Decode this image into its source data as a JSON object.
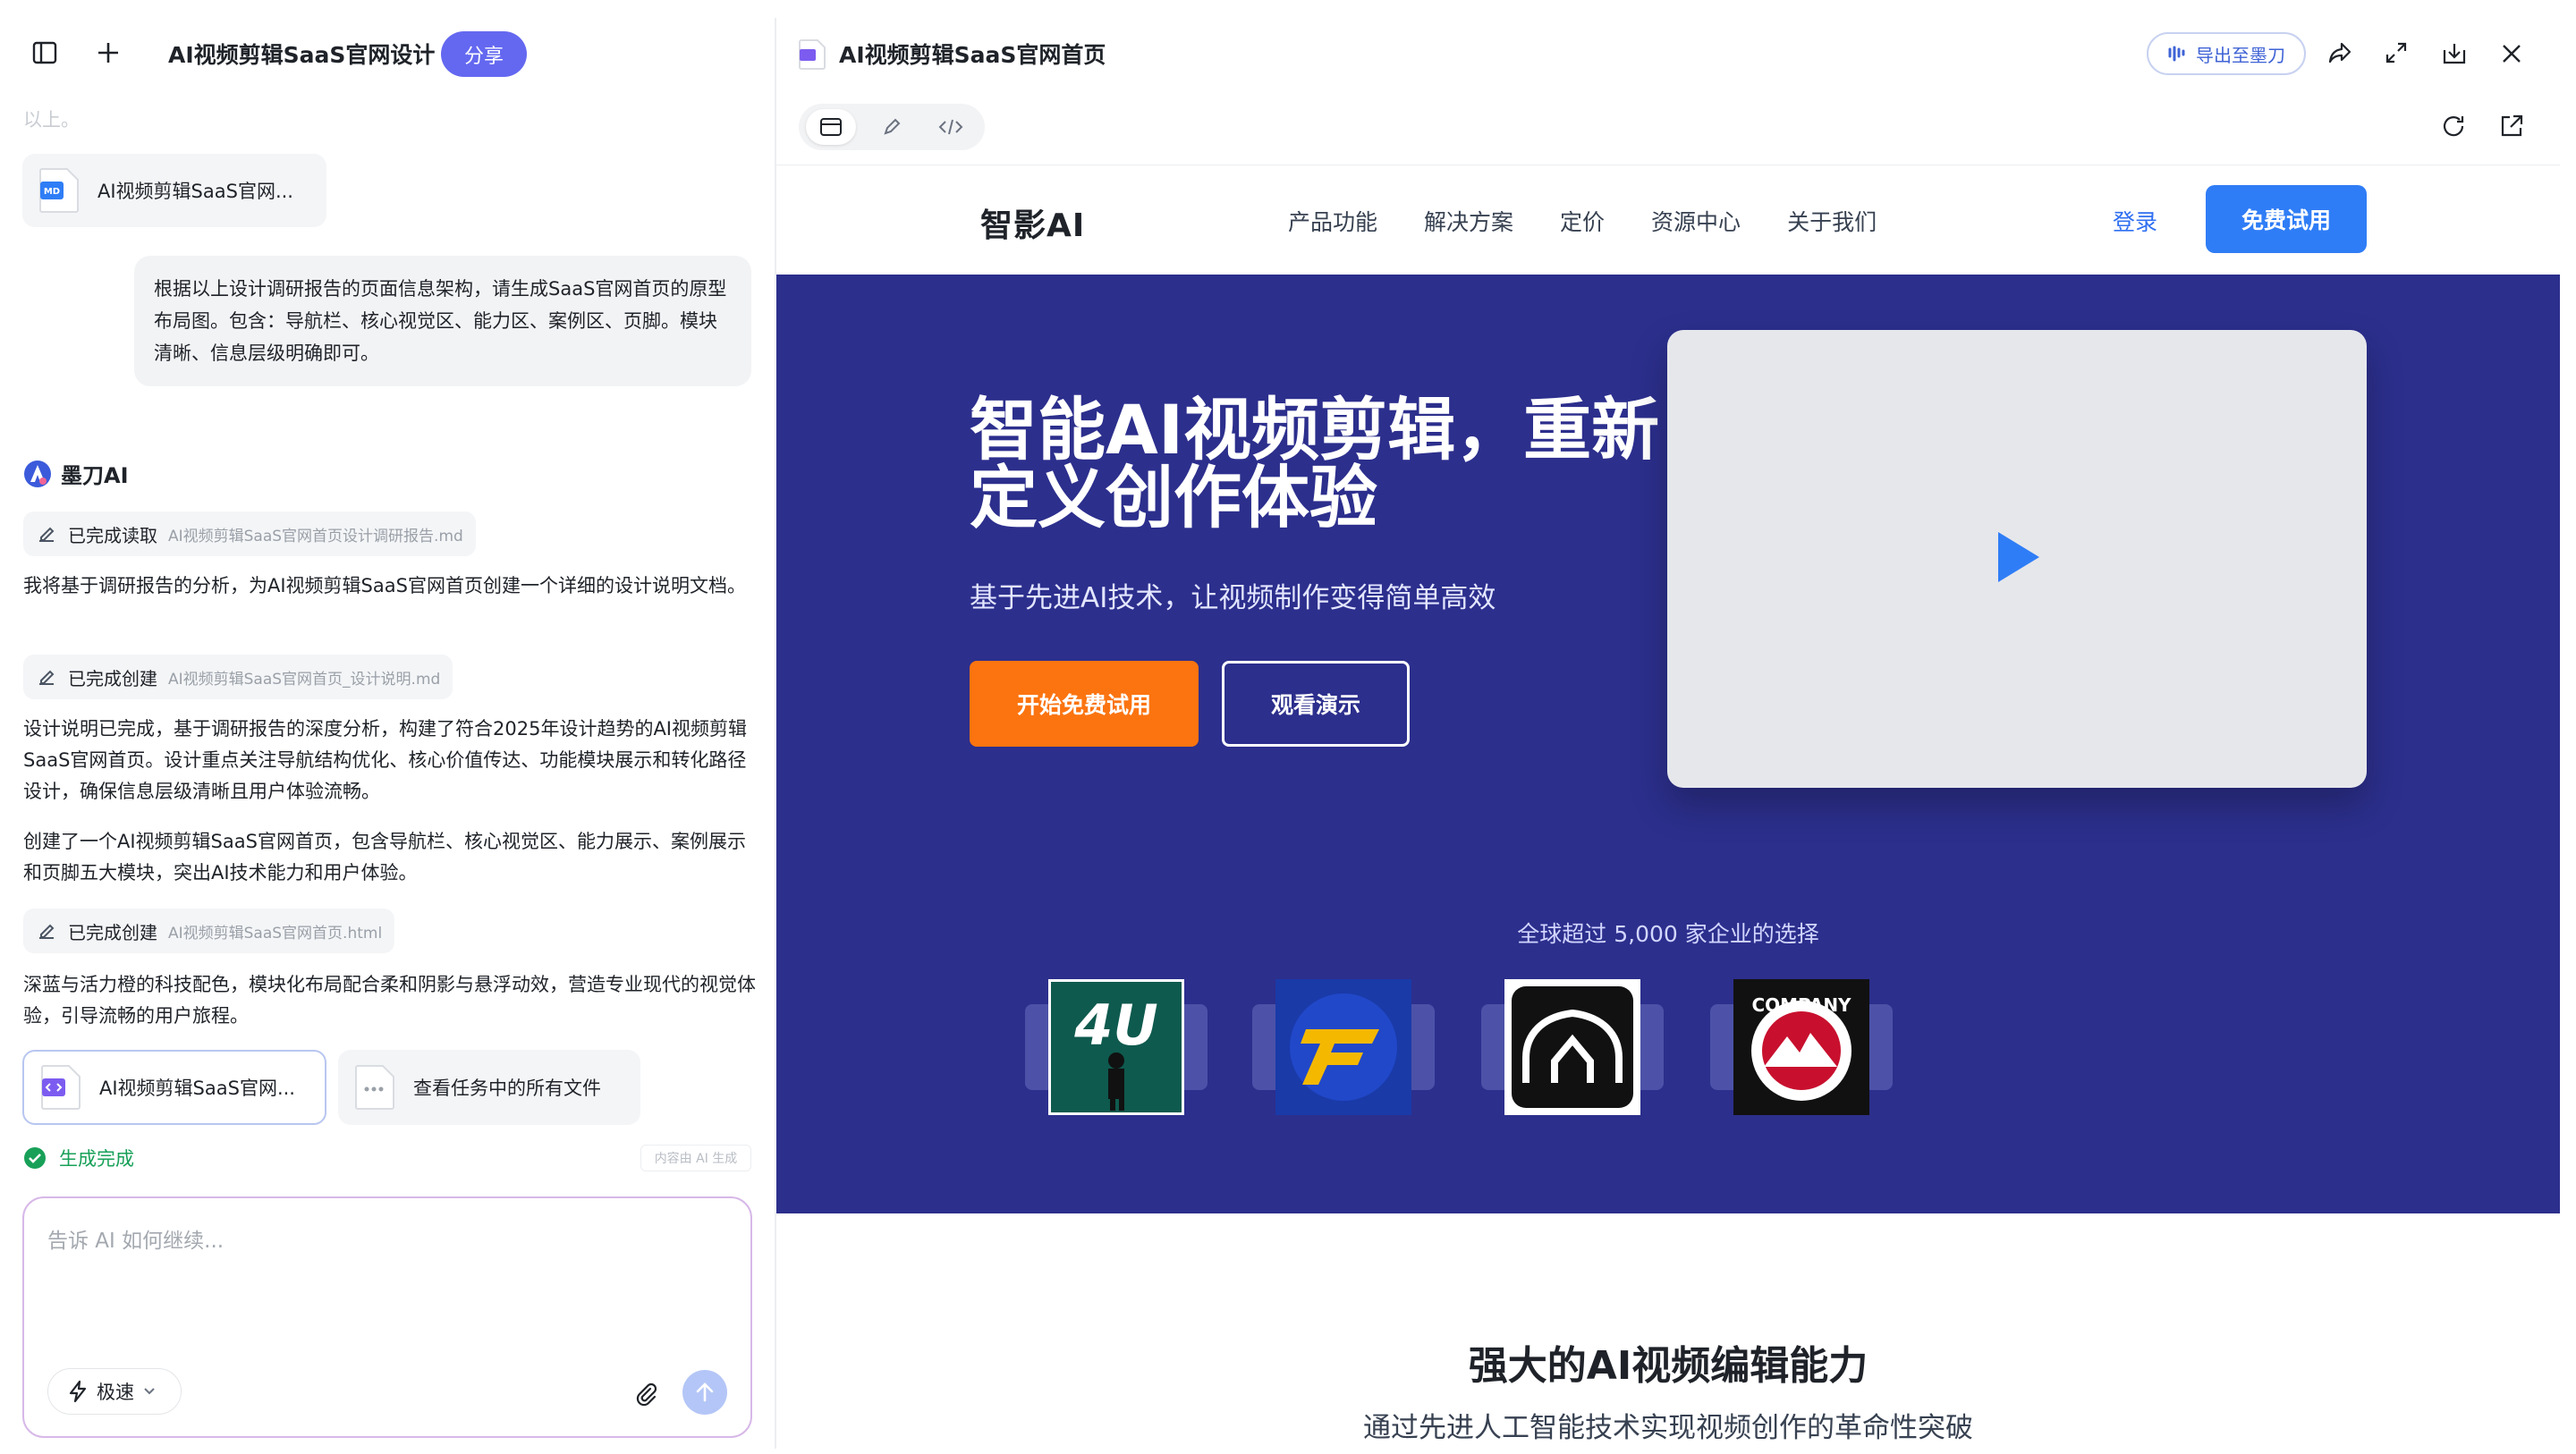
{
  "left_panel": {
    "project_title": "AI视频剪辑SaaS官网设计",
    "share_label": "分享",
    "faded_text": "以上。",
    "files": {
      "md_file": "AI视频剪辑SaaS官网...",
      "html_file": "AI视频剪辑SaaS官网...",
      "all_files": "查看任务中的所有文件"
    },
    "user_message": "根据以上设计调研报告的页面信息架构，请生成SaaS官网首页的原型布局图。包含：导航栏、核心视觉区、能力区、案例区、页脚。模块清晰、信息层级明确即可。",
    "agent_name": "墨刀AI",
    "steps": [
      {
        "label": "已完成读取",
        "file": "AI视频剪辑SaaS官网首页设计调研报告.md"
      },
      {
        "label": "已完成创建",
        "file": "AI视频剪辑SaaS官网首页_设计说明.md"
      },
      {
        "label": "已完成创建",
        "file": "AI视频剪辑SaaS官网首页.html"
      }
    ],
    "paragraphs": [
      "我将基于调研报告的分析，为AI视频剪辑SaaS官网首页创建一个详细的设计说明文档。",
      "设计说明已完成，基于调研报告的深度分析，构建了符合2025年设计趋势的AI视频剪辑SaaS官网首页。设计重点关注导航结构优化、核心价值传达、功能模块展示和转化路径设计，确保信息层级清晰且用户体验流畅。",
      "创建了一个AI视频剪辑SaaS官网首页，包含导航栏、核心视觉区、能力展示、案例展示和页脚五大模块，突出AI技术能力和用户体验。",
      "深蓝与活力橙的科技配色，模块化布局配合柔和阴影与悬浮动效，营造专业现代的视觉体验，引导流畅的用户旅程。"
    ],
    "done_label": "生成完成",
    "ai_tag": "内容由 AI 生成",
    "composer": {
      "placeholder": "告诉 AI 如何继续...",
      "mode_label": "极速"
    }
  },
  "right_panel": {
    "title": "AI视频剪辑SaaS官网首页",
    "export_label": "导出至墨刀",
    "site": {
      "logo": "智影AI",
      "nav": [
        "产品功能",
        "解决方案",
        "定价",
        "资源中心",
        "关于我们"
      ],
      "login": "登录",
      "trial": "免费试用",
      "hero_title": "智能AI视频剪辑，重新定义创作体验",
      "hero_sub": "基于先进AI技术，让视频制作变得简单高效",
      "cta_primary": "开始免费试用",
      "cta_secondary": "观看演示",
      "trust_text": "全球超过 5,000 家企业的选择",
      "client_logos": [
        {
          "name": "4U",
          "text": "4U"
        },
        {
          "name": "GT",
          "text": ""
        },
        {
          "name": "arch",
          "text": ""
        },
        {
          "name": "company",
          "text": "COMPANY"
        }
      ],
      "section_title": "强大的AI视频编辑能力",
      "section_sub": "通过先进人工智能技术实现视频创作的革命性突破"
    }
  },
  "colors": {
    "share": "#6468f0",
    "hero_bg": "#2c2f8c",
    "cta_orange": "#fb7410",
    "brand_blue": "#2f7df6",
    "done_green": "#18a058"
  }
}
